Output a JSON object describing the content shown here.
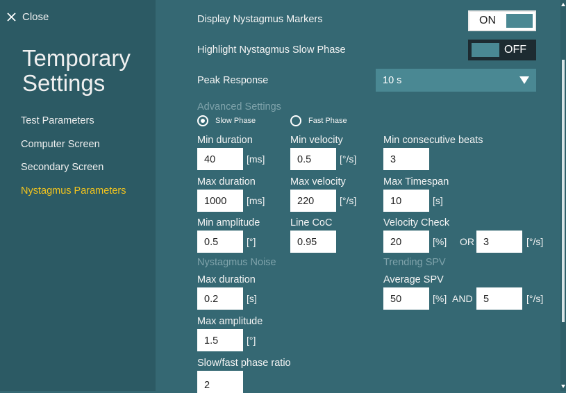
{
  "sidebar": {
    "close_label": "Close",
    "title_line1": "Temporary",
    "title_line2": "Settings",
    "items": [
      {
        "label": "Test Parameters"
      },
      {
        "label": "Computer Screen"
      },
      {
        "label": "Secondary Screen"
      },
      {
        "label": "Nystagmus Parameters",
        "active": true
      }
    ]
  },
  "display_settings": {
    "display_markers_label": "Display Nystagmus Markers",
    "display_markers_toggle": "ON",
    "highlight_slow_label": "Highlight Nystagmus Slow Phase",
    "highlight_slow_toggle": "OFF",
    "peak_response_label": "Peak Response",
    "peak_response_value": "10 s"
  },
  "advanced": {
    "section_label": "Advanced Settings",
    "slow_phase_label": "Slow Phase",
    "fast_phase_label": "Fast Phase",
    "selected_phase": "Slow Phase",
    "min_duration_label": "Min duration",
    "min_duration_value": "40",
    "min_duration_unit": "[ms]",
    "min_velocity_label": "Min velocity",
    "min_velocity_value": "0.5",
    "min_velocity_unit": "[°/s]",
    "min_beats_label": "Min consecutive beats",
    "min_beats_value": "3",
    "max_duration_label": "Max duration",
    "max_duration_value": "1000",
    "max_duration_unit": "[ms]",
    "max_velocity_label": "Max velocity",
    "max_velocity_value": "220",
    "max_velocity_unit": "[°/s]",
    "max_timespan_label": "Max Timespan",
    "max_timespan_value": "10",
    "max_timespan_unit": "[s]",
    "min_amplitude_label": "Min amplitude",
    "min_amplitude_value": "0.5",
    "min_amplitude_unit": "[°]",
    "line_coc_label": "Line CoC",
    "line_coc_value": "0.95",
    "velocity_check_label": "Velocity Check",
    "velocity_check_value": "20",
    "velocity_check_unit": "[%]",
    "velocity_check_or": "OR",
    "velocity_check_value2": "3",
    "velocity_check_unit2": "[°/s]"
  },
  "noise": {
    "section_label": "Nystagmus Noise",
    "max_duration_label": "Max duration",
    "max_duration_value": "0.2",
    "max_duration_unit": "[s]",
    "max_amplitude_label": "Max amplitude",
    "max_amplitude_value": "1.5",
    "max_amplitude_unit": "[°]",
    "ratio_label": "Slow/fast phase ratio",
    "ratio_value": "2"
  },
  "trending": {
    "section_label": "Trending SPV",
    "average_label": "Average SPV",
    "average_value": "50",
    "average_unit": "[%]",
    "and_label": "AND",
    "average_value2": "5",
    "average_unit2": "[°/s]"
  }
}
